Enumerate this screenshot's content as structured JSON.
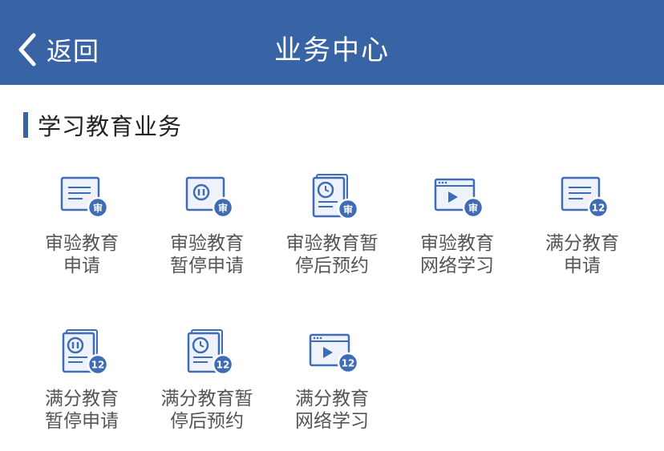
{
  "header": {
    "back_label": "返回",
    "title": "业务中心",
    "background": "#3863a4"
  },
  "section": {
    "title": "学习教育业务"
  },
  "colors": {
    "icon_stroke": "#3f6cb5",
    "badge": "#3f6cb5",
    "label_text": "#555555"
  },
  "tiles": [
    {
      "id": "review-edu-apply",
      "icon": "document-review-icon",
      "badge": "审",
      "label": "审验教育\n申请"
    },
    {
      "id": "review-edu-pause-apply",
      "icon": "pause-review-icon",
      "badge": "审",
      "label": "审验教育\n暂停申请"
    },
    {
      "id": "review-edu-resume-booking",
      "icon": "clock-review-icon",
      "badge": "审",
      "label": "审验教育暂\n停后预约"
    },
    {
      "id": "review-edu-online-study",
      "icon": "video-review-icon",
      "badge": "审",
      "label": "审验教育\n网络学习"
    },
    {
      "id": "full-score-edu-apply",
      "icon": "document-points-icon",
      "badge": "12",
      "label": "满分教育\n申请"
    },
    {
      "id": "full-score-edu-pause-apply",
      "icon": "pause-points-icon",
      "badge": "12",
      "label": "满分教育\n暂停申请"
    },
    {
      "id": "full-score-edu-resume-booking",
      "icon": "clock-points-icon",
      "badge": "12",
      "label": "满分教育暂\n停后预约"
    },
    {
      "id": "full-score-edu-online-study",
      "icon": "video-points-icon",
      "badge": "12",
      "label": "满分教育\n网络学习"
    }
  ]
}
